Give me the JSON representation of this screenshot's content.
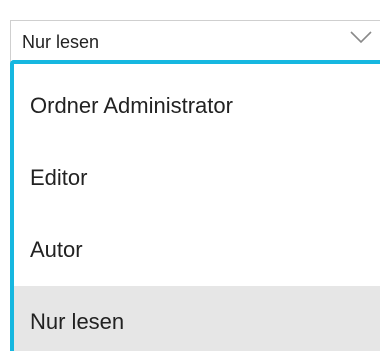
{
  "select": {
    "value": "Nur lesen",
    "chevron_icon": "chevron-down-icon"
  },
  "menu": {
    "accent_color": "#16b7e0",
    "selected_background": "#e6e6e6",
    "items": [
      {
        "label": "Ordner Administrator",
        "selected": false
      },
      {
        "label": "Editor",
        "selected": false
      },
      {
        "label": "Autor",
        "selected": false
      },
      {
        "label": "Nur lesen",
        "selected": true
      }
    ]
  }
}
